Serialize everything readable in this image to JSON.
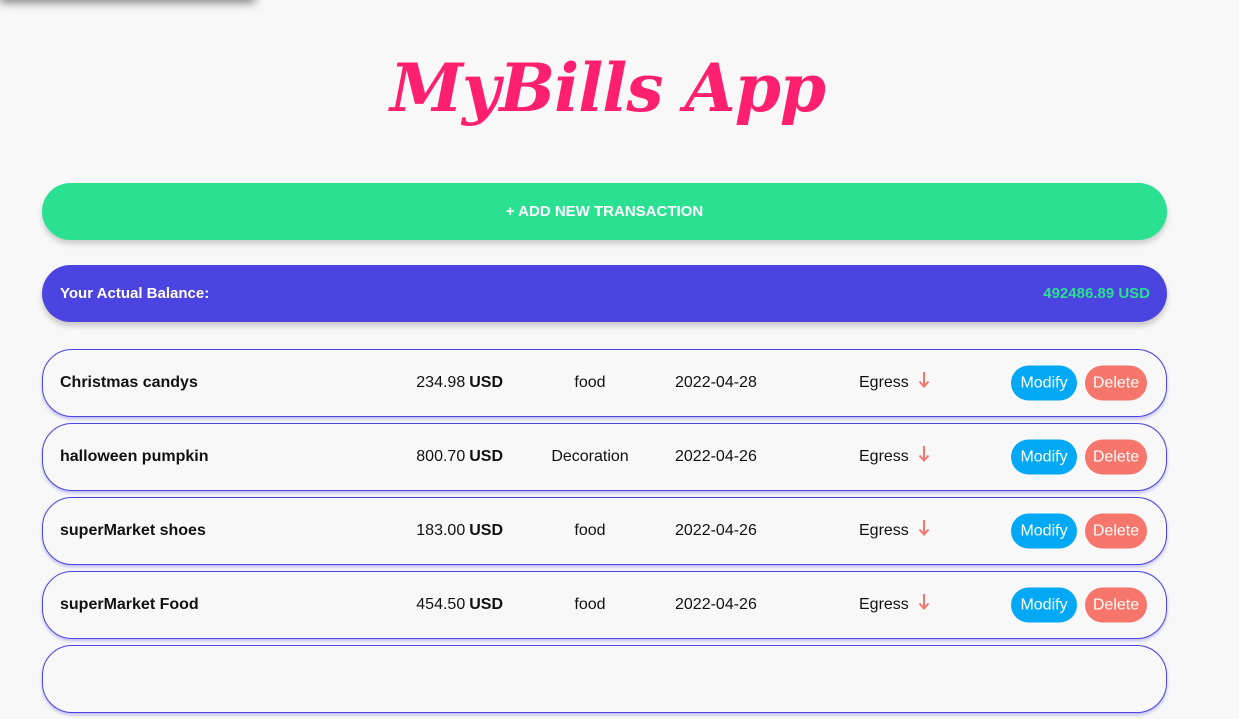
{
  "app": {
    "title": "MyBills App"
  },
  "actions": {
    "add_label": "+ ADD NEW TRANSACTION"
  },
  "balance": {
    "label": "Your Actual Balance:",
    "amount": "492486.89 USD"
  },
  "transactions": [
    {
      "name": "Christmas candys",
      "amount": "234.98",
      "currency": "USD",
      "category": "food",
      "date": "2022-04-28",
      "type": "Egress",
      "modify_label": "Modify",
      "delete_label": "Delete"
    },
    {
      "name": "halloween pumpkin",
      "amount": "800.70",
      "currency": "USD",
      "category": "Decoration",
      "date": "2022-04-26",
      "type": "Egress",
      "modify_label": "Modify",
      "delete_label": "Delete"
    },
    {
      "name": "superMarket shoes",
      "amount": "183.00",
      "currency": "USD",
      "category": "food",
      "date": "2022-04-26",
      "type": "Egress",
      "modify_label": "Modify",
      "delete_label": "Delete"
    },
    {
      "name": "superMarket Food",
      "amount": "454.50",
      "currency": "USD",
      "category": "food",
      "date": "2022-04-26",
      "type": "Egress",
      "modify_label": "Modify",
      "delete_label": "Delete"
    },
    {
      "name": "",
      "amount": "",
      "currency": "",
      "category": "",
      "date": "",
      "type": "",
      "modify_label": "",
      "delete_label": ""
    }
  ],
  "icons": {
    "egress": "arrow-down-icon"
  },
  "colors": {
    "title": "#ff1f6f",
    "add_button": "#2ae192",
    "balance_bar": "#4b44e0",
    "balance_amount": "#2ae192",
    "modify_button": "#03a9f4",
    "delete_button": "#f7766c",
    "egress_arrow": "#f7766c"
  }
}
